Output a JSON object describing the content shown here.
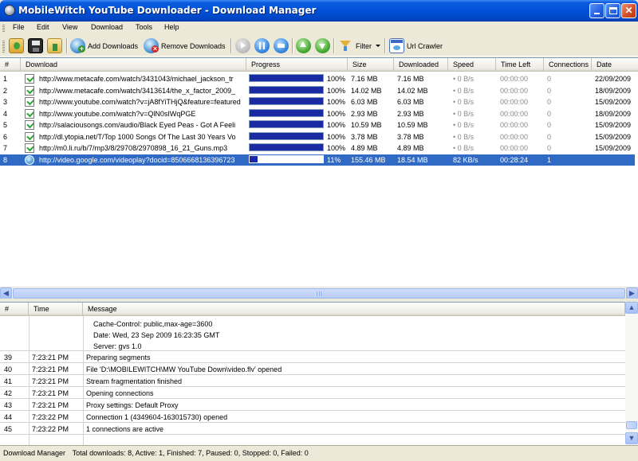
{
  "window": {
    "title": "MobileWitch YouTube Downloader - Download Manager"
  },
  "menu": [
    "File",
    "Edit",
    "View",
    "Download",
    "Tools",
    "Help"
  ],
  "toolbar": {
    "add_downloads": "Add Downloads",
    "remove_downloads": "Remove Downloads",
    "filter": "Filter",
    "url_crawler": "Url Crawler"
  },
  "downloads": {
    "headers": [
      "#",
      "Download",
      "Progress",
      "Size",
      "Downloaded",
      "Speed",
      "Time Left",
      "Connections",
      "Date"
    ],
    "rows": [
      {
        "num": "1",
        "url": "http://www.metacafe.com/watch/3431043/michael_jackson_tr",
        "progress": 100,
        "pct": "100%",
        "size": "7.16 MB",
        "downloaded": "7.16 MB",
        "speed": "0 B/s",
        "time_left": "00:00:00",
        "connections": "0",
        "date": "22/09/2009",
        "icon": "file-check"
      },
      {
        "num": "2",
        "url": "http://www.metacafe.com/watch/3413614/the_x_factor_2009_",
        "progress": 100,
        "pct": "100%",
        "size": "14.02 MB",
        "downloaded": "14.02 MB",
        "speed": "0 B/s",
        "time_left": "00:00:00",
        "connections": "0",
        "date": "18/09/2009",
        "icon": "file-check"
      },
      {
        "num": "3",
        "url": "http://www.youtube.com/watch?v=jA8fYiTHjQ&feature=featured",
        "progress": 100,
        "pct": "100%",
        "size": "6.03 MB",
        "downloaded": "6.03 MB",
        "speed": "0 B/s",
        "time_left": "00:00:00",
        "connections": "0",
        "date": "15/09/2009",
        "icon": "file-check"
      },
      {
        "num": "4",
        "url": "http://www.youtube.com/watch?v=QlN0sIWqPGE",
        "progress": 100,
        "pct": "100%",
        "size": "2.93 MB",
        "downloaded": "2.93 MB",
        "speed": "0 B/s",
        "time_left": "00:00:00",
        "connections": "0",
        "date": "18/09/2009",
        "icon": "file-check"
      },
      {
        "num": "5",
        "url": "http://salaciousongs.com/audio/Black Eyed Peas - Got A Feeli",
        "progress": 100,
        "pct": "100%",
        "size": "10.59 MB",
        "downloaded": "10.59 MB",
        "speed": "0 B/s",
        "time_left": "00:00:00",
        "connections": "0",
        "date": "15/09/2009",
        "icon": "file-check"
      },
      {
        "num": "6",
        "url": "http://dl.ytopia.net/T/Top 1000 Songs Of The Last 30 Years Vo",
        "progress": 100,
        "pct": "100%",
        "size": "3.78 MB",
        "downloaded": "3.78 MB",
        "speed": "0 B/s",
        "time_left": "00:00:00",
        "connections": "0",
        "date": "15/09/2009",
        "icon": "file-check"
      },
      {
        "num": "7",
        "url": "http://m0.li.ru/b/7/mp3/8/29708/2970898_16_21_Guns.mp3",
        "progress": 100,
        "pct": "100%",
        "size": "4.89 MB",
        "downloaded": "4.89 MB",
        "speed": "0 B/s",
        "time_left": "00:00:00",
        "connections": "0",
        "date": "15/09/2009",
        "icon": "file-check"
      },
      {
        "num": "8",
        "url": "http://video.google.com/videoplay?docid=8506668136396723",
        "progress": 11,
        "pct": "11%",
        "size": "155.46 MB",
        "downloaded": "18.54 MB",
        "speed": "82 KB/s",
        "time_left": "00:28:24",
        "connections": "1",
        "date": "",
        "icon": "globe",
        "selected": true
      }
    ]
  },
  "log": {
    "headers": [
      "#",
      "Time",
      "Message"
    ],
    "header_lines": [
      "Cache-Control: public,max-age=3600",
      "Date: Wed, 23 Sep 2009 16:23:35 GMT",
      "Server: gvs 1.0"
    ],
    "rows": [
      {
        "num": "39",
        "time": "7:23:21 PM",
        "message": "Preparing segments"
      },
      {
        "num": "40",
        "time": "7:23:21 PM",
        "message": "File 'D:\\MOBILEWITCH\\MW YouTube Down\\video.flv' opened"
      },
      {
        "num": "41",
        "time": "7:23:21 PM",
        "message": "Stream fragmentation finished"
      },
      {
        "num": "42",
        "time": "7:23:21 PM",
        "message": "Opening connections"
      },
      {
        "num": "43",
        "time": "7:23:21 PM",
        "message": "Proxy settings: Default Proxy"
      },
      {
        "num": "44",
        "time": "7:23:22 PM",
        "message": "Connection 1 (4349604-163015730) opened"
      },
      {
        "num": "45",
        "time": "7:23:22 PM",
        "message": "1 connections are active"
      }
    ]
  },
  "status": {
    "label": "Download Manager",
    "summary": "Total downloads: 8, Active: 1, Finished: 7, Paused: 0, Stopped: 0, Failed: 0"
  },
  "colors": {
    "selection": "#316ac5",
    "progress_fill": "#1a2aa3",
    "titlebar": "#0050d8"
  }
}
